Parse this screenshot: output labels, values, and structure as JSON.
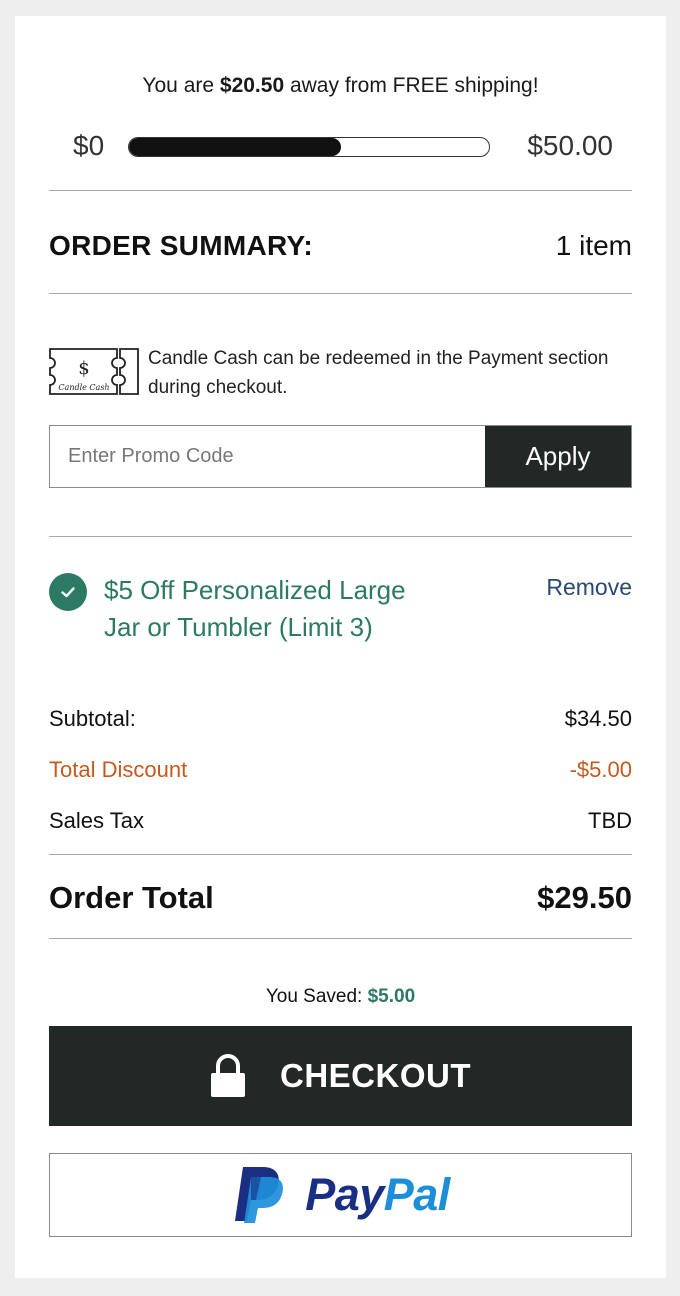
{
  "shipping": {
    "prefix": "You are ",
    "amount_away": "$20.50",
    "suffix": " away from FREE shipping!",
    "progress_start": "$0",
    "progress_end": "$50.00",
    "progress_fraction": 0.59
  },
  "summary": {
    "title": "ORDER SUMMARY:",
    "item_count": "1 item"
  },
  "candle_cash": {
    "message": "Candle Cash can be redeemed in the Payment section during checkout.",
    "ticket_symbol": "$",
    "ticket_text": "Candle Cash"
  },
  "promo": {
    "placeholder": "Enter Promo Code",
    "value": "",
    "apply_label": "Apply"
  },
  "applied_coupon": {
    "name": "$5 Off Personalized Large Jar or Tumbler (Limit 3)",
    "remove_label": "Remove"
  },
  "lines": {
    "subtotal_label": "Subtotal:",
    "subtotal_value": "$34.50",
    "discount_label": "Total Discount",
    "discount_value": "-$5.00",
    "tax_label": "Sales Tax",
    "tax_value": "TBD"
  },
  "total": {
    "label": "Order Total",
    "value": "$29.50"
  },
  "saved": {
    "label": "You Saved: ",
    "value": "$5.00"
  },
  "checkout": {
    "label": "CHECKOUT",
    "icon": "lock-icon"
  },
  "paypal": {
    "word_part1": "Pay",
    "word_part2": "Pal"
  },
  "colors": {
    "accent_green": "#2c7a64",
    "discount_orange": "#c65a1e",
    "dark_button": "#222825",
    "link_blue": "#2a4a72",
    "paypal_dark": "#1a2e84",
    "paypal_light": "#1d8fd9"
  }
}
